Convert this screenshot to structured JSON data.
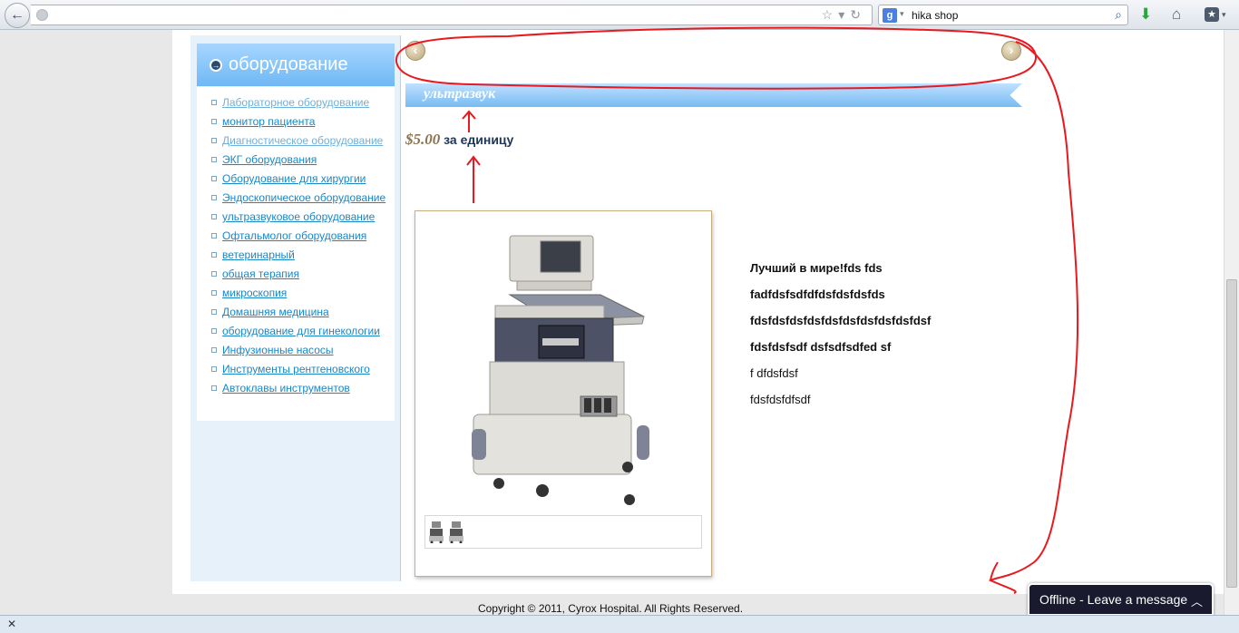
{
  "browser": {
    "search_engine_letter": "g",
    "search_value": "hika shop",
    "url": ""
  },
  "sidebar": {
    "title": "оборудование",
    "items": [
      {
        "label": "Лабораторное оборудование"
      },
      {
        "label": "монитор пациента"
      },
      {
        "label": "Диагностическое оборудование"
      },
      {
        "label": "ЭКГ оборудования"
      },
      {
        "label": "Оборудование для хирургии"
      },
      {
        "label": "Эндоскопическое оборудование"
      },
      {
        "label": "ультразвуковое оборудование"
      },
      {
        "label": "Офтальмолог оборудования"
      },
      {
        "label": "ветеринарный"
      },
      {
        "label": "общая терапия"
      },
      {
        "label": "микроскопия"
      },
      {
        "label": "Домашняя медицина"
      },
      {
        "label": "оборудование для гинекологии"
      },
      {
        "label": "Инфузионные насосы"
      },
      {
        "label": "Инструменты рентгеновского"
      },
      {
        "label": "Автоклавы инструментов"
      }
    ]
  },
  "product": {
    "category": "ультразвук",
    "price": "$5.00",
    "price_unit": "за единицу",
    "description": [
      {
        "text": "Лучший в мире!fds fds",
        "bold": true
      },
      {
        "text": "fadfdsfsdfdfdsfdsfdsfds",
        "bold": true
      },
      {
        "text": "fdsfdsfdsfdsfdsfdsfdsfdsfdsfdsf",
        "bold": true
      },
      {
        "text": "fdsfdsfsdf dsfsdfsdfed sf",
        "bold": true
      },
      {
        "text": "f dfdsfdsf",
        "bold": false
      },
      {
        "text": "fdsfdsfdfsdf",
        "bold": false
      }
    ]
  },
  "footer": {
    "copyright": "Copyright © 2011, Cyrox Hospital. All Rights Reserved."
  },
  "chat": {
    "label": "Offline - Leave a message"
  },
  "colors": {
    "annotation": "#e8191f",
    "link": "#1a86c7",
    "ribbon": "#78bbf2"
  }
}
